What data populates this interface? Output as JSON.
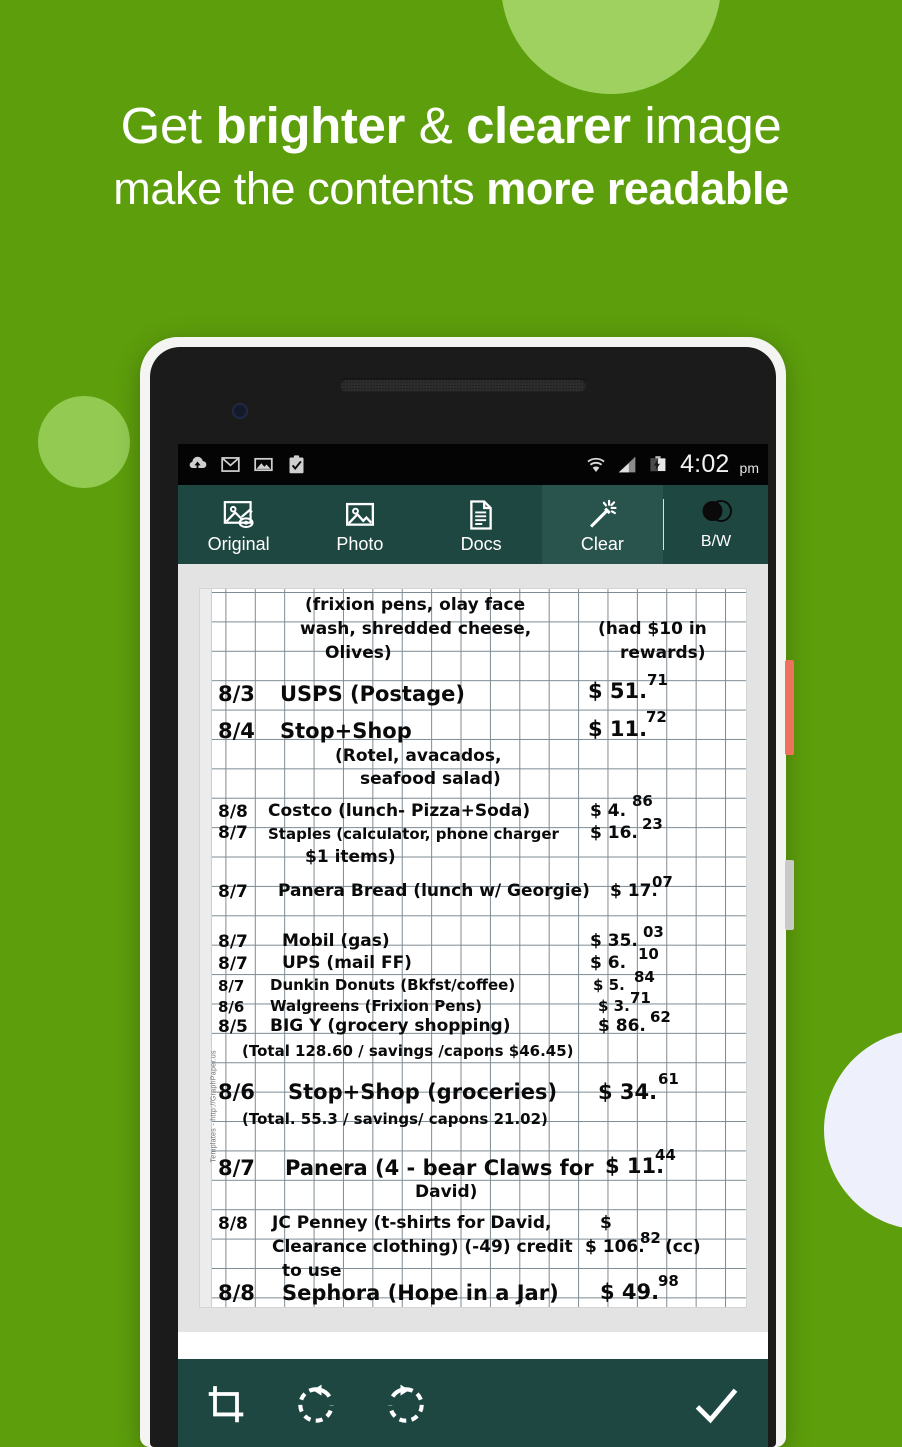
{
  "theme": {
    "bg_green": "#5d9e0c",
    "blob_light_green": "#9ed160",
    "blob_white": "#eef1fb",
    "toolbar_teal": "#1f4742",
    "toolbar_active": "#29534d",
    "accent_red_button": "#f0705e"
  },
  "headline": {
    "line1_a": "Get ",
    "line1_b": "brighter",
    "line1_c": " & ",
    "line1_d": "clearer",
    "line1_e": " image",
    "line2_a": "make the contents ",
    "line2_b": "more readable"
  },
  "status_bar": {
    "icons": [
      "cloud-upload-icon",
      "gmail-icon",
      "photo-icon",
      "clipboard-check-icon",
      "wifi-icon",
      "signal-icon",
      "battery-charging-icon"
    ],
    "time": "4:02",
    "ampm": "pm"
  },
  "toolbar": {
    "tabs": [
      {
        "label": "Original",
        "icon": "image-preview-icon",
        "active": false
      },
      {
        "label": "Photo",
        "icon": "landscape-image-icon",
        "active": false
      },
      {
        "label": "Docs",
        "icon": "document-icon",
        "active": false
      },
      {
        "label": "Clear",
        "icon": "magic-wand-icon",
        "active": true
      }
    ],
    "bw_toggle": {
      "label": "B/W",
      "icon": "contrast-circles-icon"
    }
  },
  "bottom_bar": {
    "buttons": [
      {
        "name": "crop-button",
        "icon": "crop-icon"
      },
      {
        "name": "rotate-left-button",
        "icon": "rotate-counterclockwise-icon"
      },
      {
        "name": "rotate-right-button",
        "icon": "rotate-clockwise-icon"
      },
      {
        "name": "confirm-button",
        "icon": "checkmark-icon"
      }
    ]
  },
  "document": {
    "watermark": "Templates - http://GraphPaper.us",
    "paper_type": "graph-paper",
    "lines": [
      {
        "id": "l01",
        "text": "(frixion pens, olay face"
      },
      {
        "id": "l02",
        "text": "wash, shredded cheese,"
      },
      {
        "id": "l03",
        "text": "(had $10 in"
      },
      {
        "id": "l04",
        "text": "Olives)"
      },
      {
        "id": "l05",
        "text": "rewards)"
      },
      {
        "id": "l06",
        "date": "8/3",
        "desc": "USPS (Postage)",
        "amount": "$ 51.",
        "cents": "71"
      },
      {
        "id": "l07",
        "date": "8/4",
        "desc": "Stop+Shop",
        "amount": "$ 11.",
        "cents": "72"
      },
      {
        "id": "l08",
        "text": "(Rotel, avacados,"
      },
      {
        "id": "l09",
        "text": "seafood salad)"
      },
      {
        "id": "l10",
        "date": "8/8",
        "desc": "Costco (lunch- Pizza+Soda)",
        "amount": "$ 4.",
        "cents": "86"
      },
      {
        "id": "l11",
        "date": "8/7",
        "desc": "Staples (calculator, phone charger",
        "amount": "$ 16.",
        "cents": "23"
      },
      {
        "id": "l12",
        "text": "$1 items)"
      },
      {
        "id": "l13",
        "date": "8/7",
        "desc": "Panera Bread (lunch w/ Georgie)",
        "amount": "$ 17.",
        "cents": "07"
      },
      {
        "id": "l14",
        "date": "8/7",
        "desc": "Mobil (gas)",
        "amount": "$ 35.",
        "cents": "03"
      },
      {
        "id": "l15",
        "date": "8/7",
        "desc": "UPS (mail FF)",
        "amount": "$ 6.",
        "cents": "10"
      },
      {
        "id": "l16",
        "date": "8/7",
        "desc": "Dunkin Donuts (Bkfst/coffee)",
        "amount": "$ 5.",
        "cents": "84"
      },
      {
        "id": "l17",
        "date": "8/6",
        "desc": "Walgreens (Frixion Pens)",
        "amount": "$ 3.",
        "cents": "71"
      },
      {
        "id": "l18",
        "date": "8/5",
        "desc": "BIG Y (grocery shopping)",
        "amount": "$ 86.",
        "cents": "62"
      },
      {
        "id": "l19",
        "text": "(Total 128.60 / savings /capons $46.45)"
      },
      {
        "id": "l20",
        "date": "8/6",
        "desc": "Stop+Shop (groceries)",
        "amount": "$ 34.",
        "cents": "61"
      },
      {
        "id": "l21",
        "text": "(Total. 55.3 / savings/ capons 21.02)"
      },
      {
        "id": "l22",
        "date": "8/7",
        "desc": "Panera (4 - bear Claws for",
        "amount": "$ 11.",
        "cents": "44"
      },
      {
        "id": "l23",
        "text": "David)"
      },
      {
        "id": "l24",
        "date": "8/8",
        "desc": "JC Penney (t-shirts for David,",
        "amount": "$",
        "cents": ""
      },
      {
        "id": "l25",
        "text": "Clearance clothing) (-49) credit",
        "amount": "$ 106.",
        "cents": "82",
        "suffix": "(cc)"
      },
      {
        "id": "l26",
        "text": "to use"
      },
      {
        "id": "l27",
        "date": "8/8",
        "desc": "Sephora (Hope in a Jar)",
        "amount": "$ 49.",
        "cents": "98"
      }
    ]
  }
}
